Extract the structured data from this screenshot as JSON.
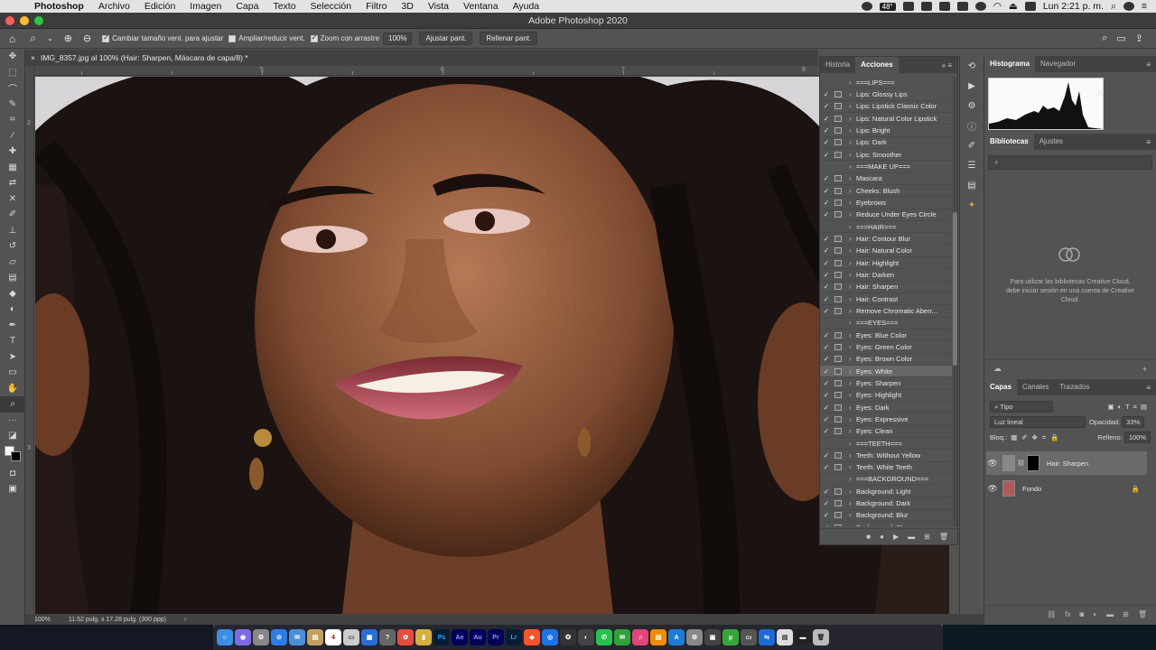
{
  "menubar": {
    "items": [
      "Photoshop",
      "Archivo",
      "Edición",
      "Imagen",
      "Capa",
      "Texto",
      "Selección",
      "Filtro",
      "3D",
      "Vista",
      "Ventana",
      "Ayuda"
    ],
    "temperature": "48°",
    "clock": "Lun 2:21 p. m."
  },
  "window": {
    "title": "Adobe Photoshop 2020"
  },
  "options": {
    "chk_resize": "Cambiar tamaño vent. para ajustar",
    "chk_zoom_all": "Ampliar/reducir vent.",
    "chk_scrubby": "Zoom con arrastre",
    "zoom_value": "100%",
    "fit_button": "Ajustar pant.",
    "fill_button": "Rellenar pant."
  },
  "document": {
    "tab_title": "IMG_8357.jpg al 100% (Hair: Sharpen, Máscara de capa/8) *",
    "ruler_numbers": [
      "5",
      "6",
      "7",
      "8"
    ],
    "ruler_v_numbers": [
      "2",
      "3"
    ]
  },
  "status": {
    "zoom": "100%",
    "doc_size": "11.52 pulg. x 17.28 pulg. (300 ppp)"
  },
  "actions_panel": {
    "tabs": [
      "Historia",
      "Acciones"
    ],
    "active_tab": "Acciones",
    "items": [
      {
        "label": "===LIPS===",
        "check": false,
        "dlg": false
      },
      {
        "label": "Lips: Glossy Lips",
        "check": true,
        "dlg": true
      },
      {
        "label": "Lips: Lipstick Classic Color",
        "check": true,
        "dlg": true
      },
      {
        "label": "Lips: Natural Color Lipstick",
        "check": true,
        "dlg": true
      },
      {
        "label": "Lips: Bright",
        "check": true,
        "dlg": true
      },
      {
        "label": "Lips: Dark",
        "check": true,
        "dlg": true
      },
      {
        "label": "Lips: Smoother",
        "check": true,
        "dlg": true
      },
      {
        "label": "===MAKE UP===",
        "check": false,
        "dlg": false
      },
      {
        "label": "Mascara",
        "check": true,
        "dlg": true
      },
      {
        "label": "Cheeks: Blush",
        "check": true,
        "dlg": true
      },
      {
        "label": "Eyebrows",
        "check": true,
        "dlg": true
      },
      {
        "label": "Reduce Under Eyes Circle",
        "check": true,
        "dlg": true
      },
      {
        "label": "===HAIR===",
        "check": false,
        "dlg": false
      },
      {
        "label": "Hair: Contour Blur",
        "check": true,
        "dlg": true
      },
      {
        "label": "Hair: Natural Color",
        "check": true,
        "dlg": true
      },
      {
        "label": "Hair: Highlight",
        "check": true,
        "dlg": true
      },
      {
        "label": "Hair: Darken",
        "check": true,
        "dlg": true
      },
      {
        "label": "Hair: Sharpen",
        "check": true,
        "dlg": true
      },
      {
        "label": "Hair: Contrast",
        "check": true,
        "dlg": true
      },
      {
        "label": "Remove Chromatic Aberr...",
        "check": true,
        "dlg": true
      },
      {
        "label": "===EYES===",
        "check": false,
        "dlg": false
      },
      {
        "label": "Eyes: Blue Color",
        "check": true,
        "dlg": true
      },
      {
        "label": "Eyes: Green Color",
        "check": true,
        "dlg": true
      },
      {
        "label": "Eyes: Brown Color",
        "check": true,
        "dlg": true
      },
      {
        "label": "Eyes: White",
        "check": true,
        "dlg": true,
        "selected": true
      },
      {
        "label": "Eyes: Sharpen",
        "check": true,
        "dlg": true
      },
      {
        "label": "Eyes: Highlight",
        "check": true,
        "dlg": true
      },
      {
        "label": "Eyes: Dark",
        "check": true,
        "dlg": true
      },
      {
        "label": "Eyes: Expressive",
        "check": true,
        "dlg": true
      },
      {
        "label": "Eyes: Clean",
        "check": true,
        "dlg": true
      },
      {
        "label": "===TEETH===",
        "check": false,
        "dlg": false
      },
      {
        "label": "Teeth: Without Yellow",
        "check": true,
        "dlg": true
      },
      {
        "label": "Teeth: White Teeth",
        "check": true,
        "dlg": true
      },
      {
        "label": "===BACKGROUND===",
        "check": false,
        "dlg": false
      },
      {
        "label": "Background: Light",
        "check": true,
        "dlg": true
      },
      {
        "label": "Background: Dark",
        "check": true,
        "dlg": true
      },
      {
        "label": "Background: Blur",
        "check": true,
        "dlg": true
      },
      {
        "label": "Background: Sharpen",
        "check": true,
        "dlg": true
      }
    ]
  },
  "histogram_panel": {
    "tabs": [
      "Histograma",
      "Navegador"
    ],
    "active_tab": "Histograma"
  },
  "libraries_panel": {
    "tabs": [
      "Bibliotecas",
      "Ajustes"
    ],
    "active_tab": "Bibliotecas",
    "message": "Para utilizar las bibliotecas Creative Cloud, debe iniciar sesión en una cuenta de Creative Cloud."
  },
  "layers_panel": {
    "tabs": [
      "Capas",
      "Canales",
      "Trazados"
    ],
    "active_tab": "Capas",
    "filter_kind": "Tipo",
    "blend_mode": "Luz lineal",
    "opacity_label": "Opacidad:",
    "opacity_value": "33%",
    "lock_label": "Bloq.:",
    "fill_label": "Relleno:",
    "fill_value": "100%",
    "layers": [
      {
        "name": "Hair: Sharpen",
        "selected": true
      },
      {
        "name": "Fondo",
        "selected": false
      }
    ]
  },
  "colors": {
    "accent": "#2d8ceb",
    "panel": "#535353",
    "panel_dark": "#424242"
  }
}
